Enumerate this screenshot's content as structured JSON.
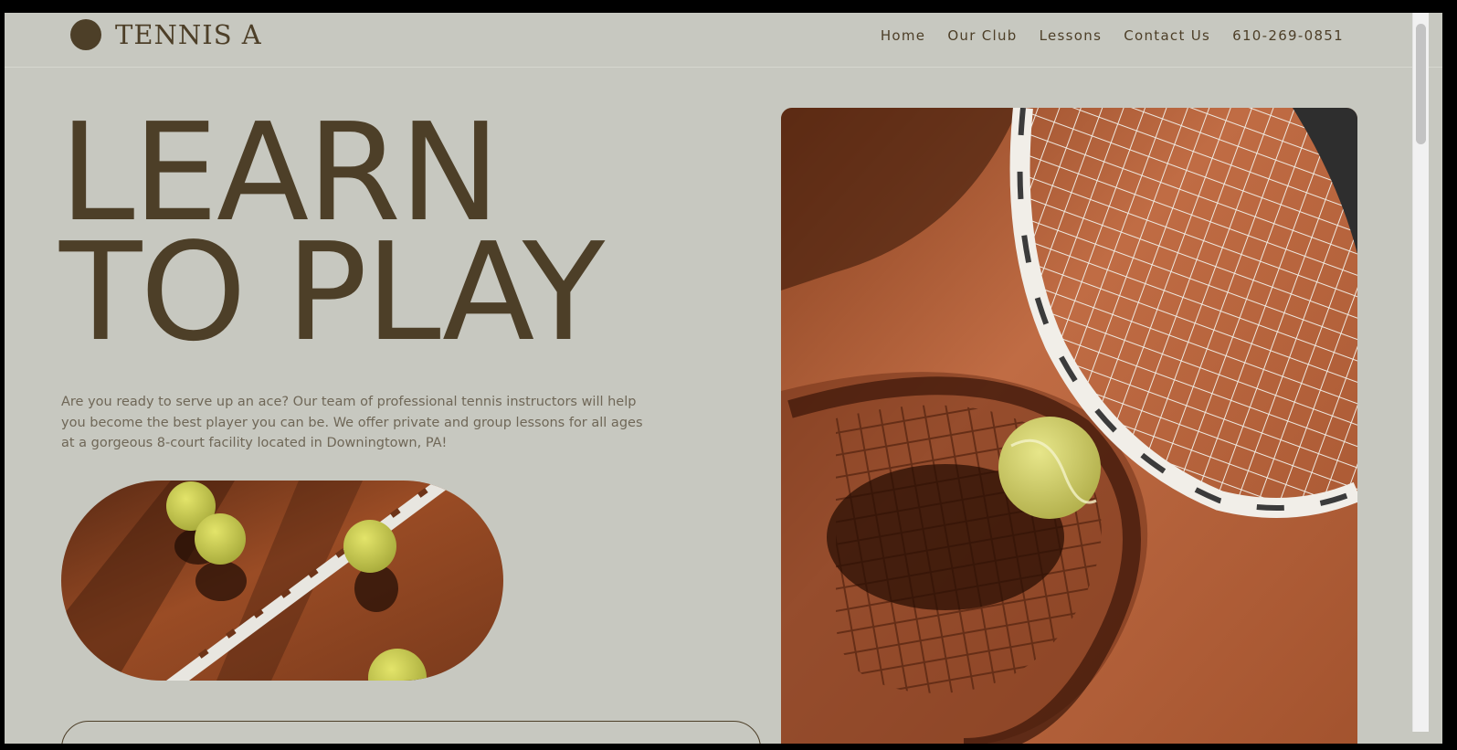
{
  "brand": {
    "name": "TENNIS A",
    "logo_icon": "filled-circle-logo",
    "color": "#4d3f28"
  },
  "nav": {
    "items": [
      {
        "label": "Home"
      },
      {
        "label": "Our Club"
      },
      {
        "label": "Lessons"
      },
      {
        "label": "Contact Us"
      },
      {
        "label": "610-269-0851"
      }
    ]
  },
  "hero": {
    "headline_line1": "LEARN",
    "headline_line2": "TO PLAY",
    "intro": "Are you ready to serve up an ace? Our team of professional tennis instructors will help you become the best player you can be. We offer private and group lessons for all ages at a gorgeous 8-court facility located in Downingtown, PA!"
  },
  "colors": {
    "background": "#c7c8c0",
    "text_primary": "#4d3f28",
    "text_body": "#6f6757",
    "clay": "#b8643c"
  }
}
